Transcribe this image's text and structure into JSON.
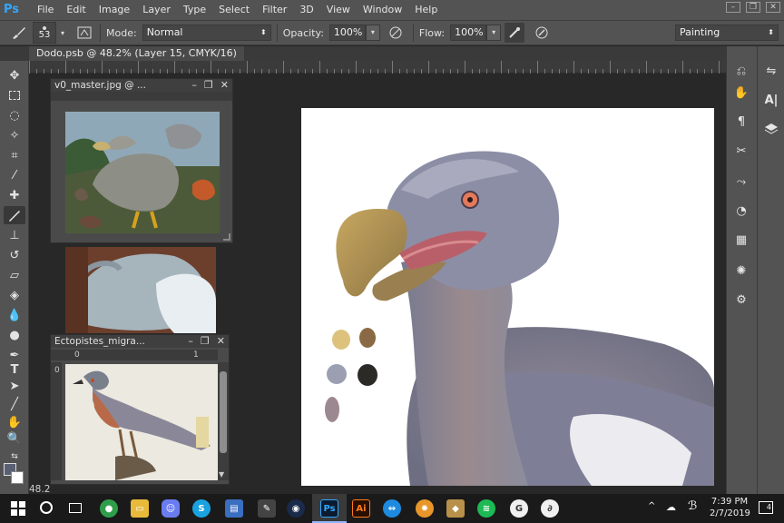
{
  "app": {
    "logo": "Ps"
  },
  "menu": [
    "File",
    "Edit",
    "Image",
    "Layer",
    "Type",
    "Select",
    "Filter",
    "3D",
    "View",
    "Window",
    "Help"
  ],
  "window_controls": [
    "–",
    "❐",
    "✕"
  ],
  "options": {
    "brush_size": "53",
    "mode_label": "Mode:",
    "mode_value": "Normal",
    "opacity_label": "Opacity:",
    "opacity_value": "100%",
    "flow_label": "Flow:",
    "flow_value": "100%",
    "workspace": "Painting"
  },
  "document": {
    "tab_title": "Dodo.psb @ 48.2% (Layer 15, CMYK/16)",
    "zoom_status": "48.2"
  },
  "floating_windows": [
    {
      "title": "v0_master.jpg @ ...",
      "controls": [
        "–",
        "❐",
        "✕"
      ]
    },
    {
      "title": "Ectopistes_migra...",
      "controls": [
        "–",
        "❐",
        "✕"
      ],
      "ruler_zero": "0",
      "ruler_one": "1",
      "ruler_left_zero": "0"
    }
  ],
  "palette_swatches": [
    "#dcc27c",
    "#8a6a44",
    "#9c9fb2",
    "#2c2a26",
    "#9c8890"
  ],
  "taskbar": {
    "time": "7:39 PM",
    "date": "2/7/2019",
    "notifications": "4"
  },
  "colors": {
    "accent_ps": "#31a8ff",
    "canvas": "#ffffff",
    "ui_panel": "#535353"
  }
}
